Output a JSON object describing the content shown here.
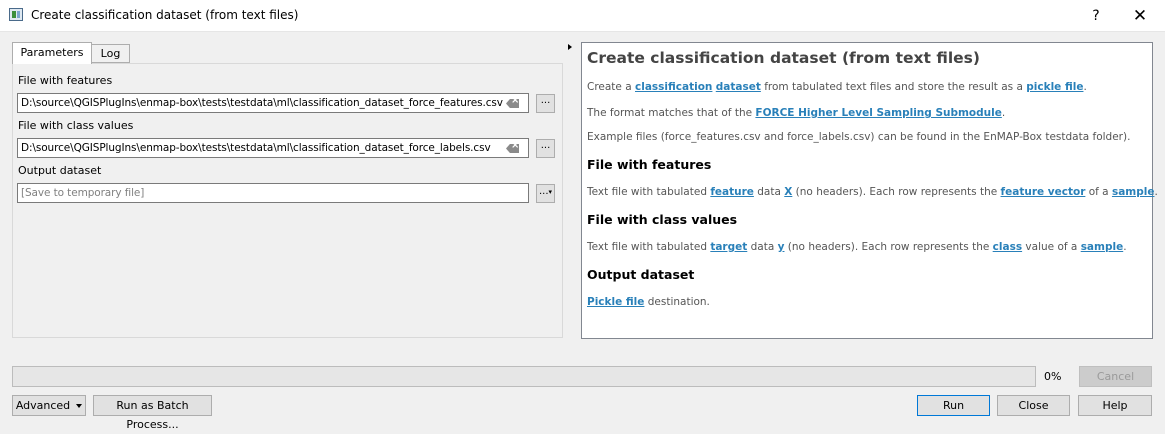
{
  "window": {
    "title": "Create classification dataset (from text files)",
    "help": "?",
    "close": "✕"
  },
  "tabs": [
    {
      "label": "Parameters"
    },
    {
      "label": "Log"
    }
  ],
  "params": {
    "features_label": "File with features",
    "features_value": "D:\\source\\QGISPlugIns\\enmap-box\\tests\\testdata\\ml\\classification_dataset_force_features.csv",
    "class_label": "File with class values",
    "class_value": "D:\\source\\QGISPlugIns\\enmap-box\\tests\\testdata\\ml\\classification_dataset_force_labels.csv",
    "output_label": "Output dataset",
    "output_placeholder": "[Save to temporary file]",
    "browse_label": "..."
  },
  "help": {
    "title": "Create classification dataset (from text files)",
    "p1_a": "Create a ",
    "p1_link1": "classification",
    "p1_link2": "dataset",
    "p1_b": " from tabulated text files and store the result as a ",
    "p1_link3": "pickle file",
    "p1_c": ".",
    "p2_a": "The format matches that of the ",
    "p2_link": "FORCE Higher Level Sampling Submodule",
    "p2_b": ".",
    "p3": "Example files (force_features.csv and force_labels.csv) can be found in the EnMAP-Box testdata folder).",
    "h_features": "File with features",
    "p4_a": "Text file with tabulated ",
    "p4_link1": "feature",
    "p4_b": " data ",
    "p4_link2": "X",
    "p4_c": " (no headers). Each row represents the ",
    "p4_link3": "feature vector",
    "p4_d": " of a ",
    "p4_link4": "sample",
    "p4_e": ".",
    "h_class": "File with class values",
    "p5_a": "Text file with tabulated ",
    "p5_link1": "target",
    "p5_b": " data ",
    "p5_link2": "y",
    "p5_c": " (no headers). Each row represents the ",
    "p5_link3": "class",
    "p5_d": " value of a ",
    "p5_link4": "sample",
    "p5_e": ".",
    "h_output": "Output dataset",
    "p6_link": "Pickle file",
    "p6_a": " destination."
  },
  "footer": {
    "progress_percent": 0,
    "progress_label": "0%",
    "cancel": "Cancel",
    "advanced": "Advanced",
    "batch": "Run as Batch Process...",
    "run": "Run",
    "close": "Close",
    "help": "Help"
  }
}
